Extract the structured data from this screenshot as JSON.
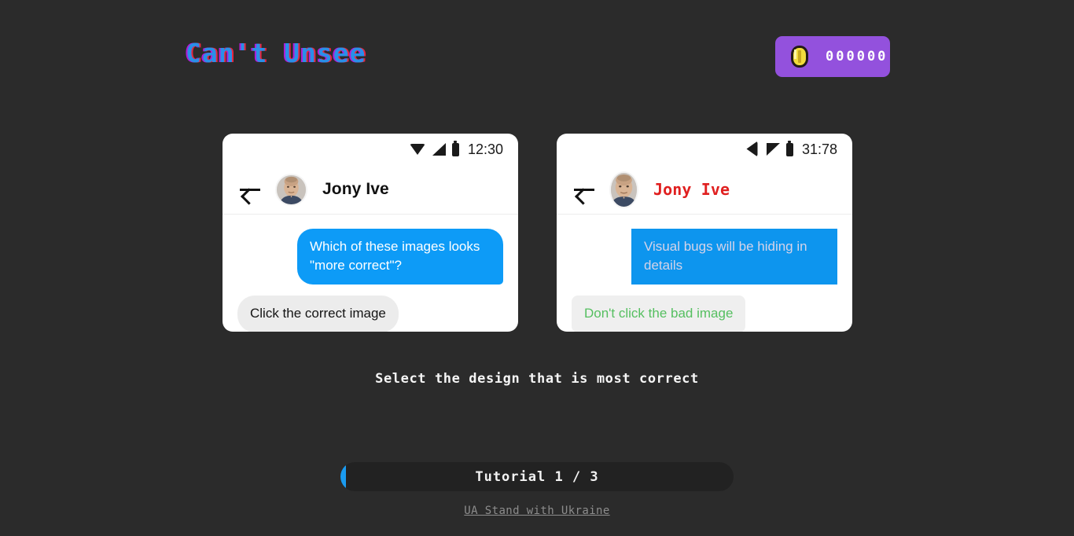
{
  "app": {
    "logo_text": "Can't Unsee",
    "background_color": "#2b2b2b"
  },
  "coin_badge": {
    "icon": "gold-coin-icon",
    "count": "000000",
    "background_color": "#9351dd"
  },
  "cards": [
    {
      "side": "left",
      "variant": "correct",
      "status_bar": {
        "wifi_icon": "wifi-icon",
        "signal_icon": "signal-bars-icon",
        "battery_icon": "battery-icon",
        "time": "12:30"
      },
      "chat_header": {
        "back_icon": "back-arrow-icon",
        "avatar": "contact-avatar",
        "contact_name": "Jony Ive",
        "name_color": "#111111"
      },
      "messages": [
        {
          "direction": "out",
          "text": "Which of these images looks \"more correct\"?",
          "bubble_color": "#0d9bf7",
          "text_color": "#ffffff"
        },
        {
          "direction": "in",
          "text": "Click the correct image",
          "bubble_color": "#ececec",
          "text_color": "#141414"
        }
      ]
    },
    {
      "side": "right",
      "variant": "buggy",
      "status_bar": {
        "wifi_icon": "wifi-icon-rotated",
        "signal_icon": "signal-bars-icon-flipped",
        "battery_icon": "battery-icon",
        "time": "31:78"
      },
      "chat_header": {
        "back_icon": "back-arrow-icon",
        "avatar": "contact-avatar-ellipse",
        "contact_name": "Jony Ive",
        "name_color": "#e02020"
      },
      "messages": [
        {
          "direction": "out",
          "text": "Visual bugs will be hiding in details",
          "bubble_color": "#0d95ee",
          "text_color": "#d5d3e8"
        },
        {
          "direction": "in",
          "text": "Don't click the bad image",
          "bubble_color": "#efefef",
          "text_color": "#55bf60"
        }
      ]
    }
  ],
  "prompt": {
    "text": "Select the design that is most correct"
  },
  "progress": {
    "label": "Tutorial 1 / 3",
    "fill_percent": 1.4,
    "fill_color": "#1a9bf0",
    "track_color": "#222222"
  },
  "footer": {
    "link_text": "UA Stand with Ukraine"
  }
}
